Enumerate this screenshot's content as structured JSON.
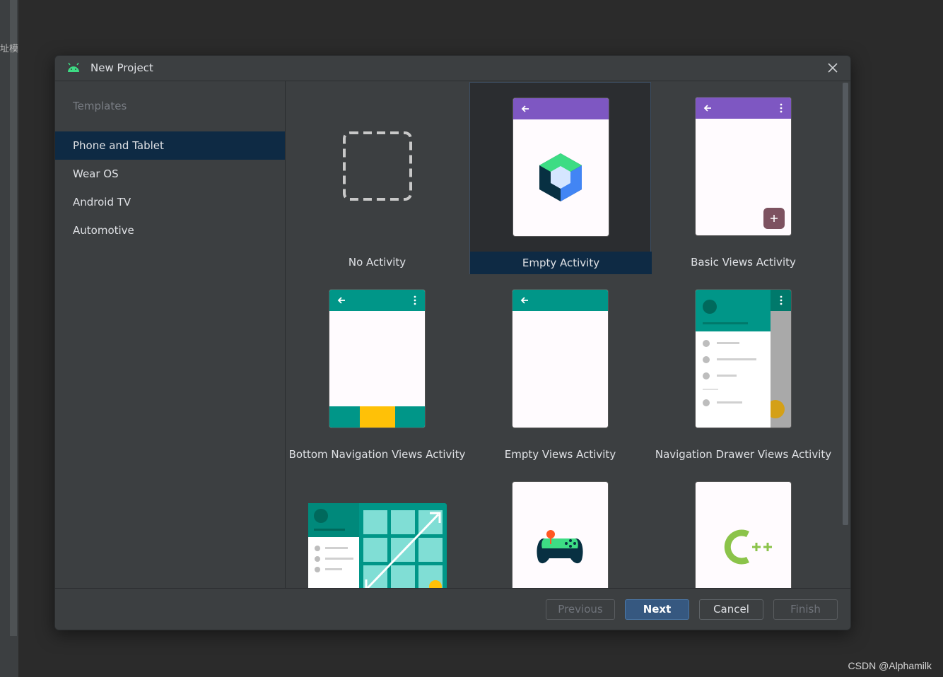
{
  "background": {
    "side_text": "址模拟",
    "watermark": "CSDN @Alphamilk"
  },
  "dialog": {
    "title": "New Project",
    "sidebar": {
      "header": "Templates",
      "items": [
        {
          "label": "Phone and Tablet",
          "selected": true
        },
        {
          "label": "Wear OS"
        },
        {
          "label": "Android TV"
        },
        {
          "label": "Automotive"
        }
      ]
    },
    "templates": [
      {
        "label": "No Activity"
      },
      {
        "label": "Empty Activity",
        "selected": true
      },
      {
        "label": "Basic Views Activity"
      },
      {
        "label": "Bottom Navigation Views Activity"
      },
      {
        "label": "Empty Views Activity"
      },
      {
        "label": "Navigation Drawer Views Activity"
      },
      {
        "label": ""
      },
      {
        "label": ""
      },
      {
        "label": ""
      }
    ],
    "buttons": {
      "previous": "Previous",
      "next": "Next",
      "cancel": "Cancel",
      "finish": "Finish"
    },
    "colors": {
      "accent_purple": "#7e57c2",
      "accent_teal": "#009688",
      "selection": "#0e2a44",
      "primary_button": "#365880"
    }
  }
}
